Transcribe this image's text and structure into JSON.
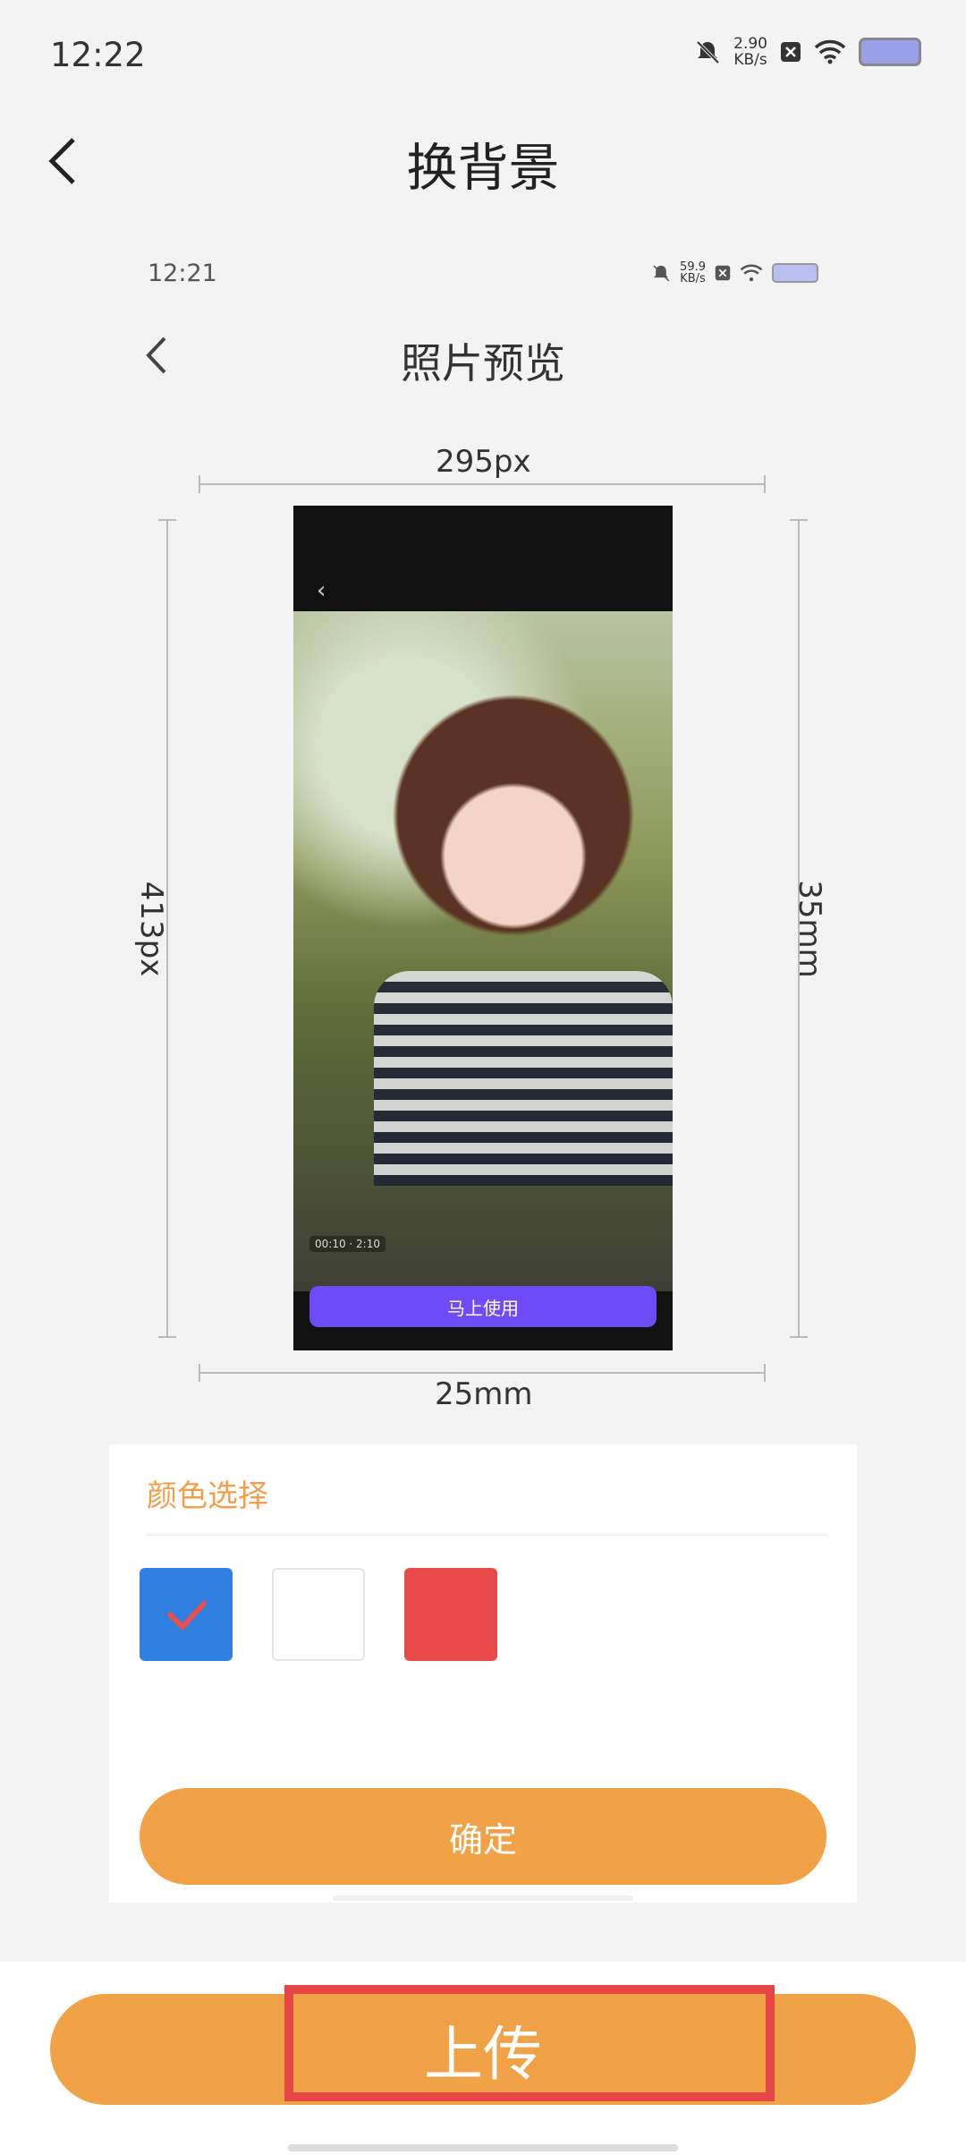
{
  "status": {
    "time": "12:22",
    "speed_value": "2.90",
    "speed_unit": "KB/s"
  },
  "header": {
    "title": "换背景"
  },
  "preview": {
    "time": "12:21",
    "speed_value": "59.9",
    "speed_unit": "KB/s",
    "title": "照片预览",
    "width_px": "295px",
    "height_px": "413px",
    "width_mm": "25mm",
    "height_mm": "35mm",
    "photo_button": "马上使用",
    "photo_timer": "00:10 · 2:10"
  },
  "color_panel": {
    "title": "颜色选择",
    "swatches": [
      {
        "name": "blue",
        "color": "#2f80e0",
        "selected": true
      },
      {
        "name": "white",
        "color": "#ffffff",
        "selected": false
      },
      {
        "name": "red",
        "color": "#e84a4a",
        "selected": false
      }
    ],
    "confirm_label": "确定"
  },
  "footer": {
    "upload_label": "上传"
  }
}
